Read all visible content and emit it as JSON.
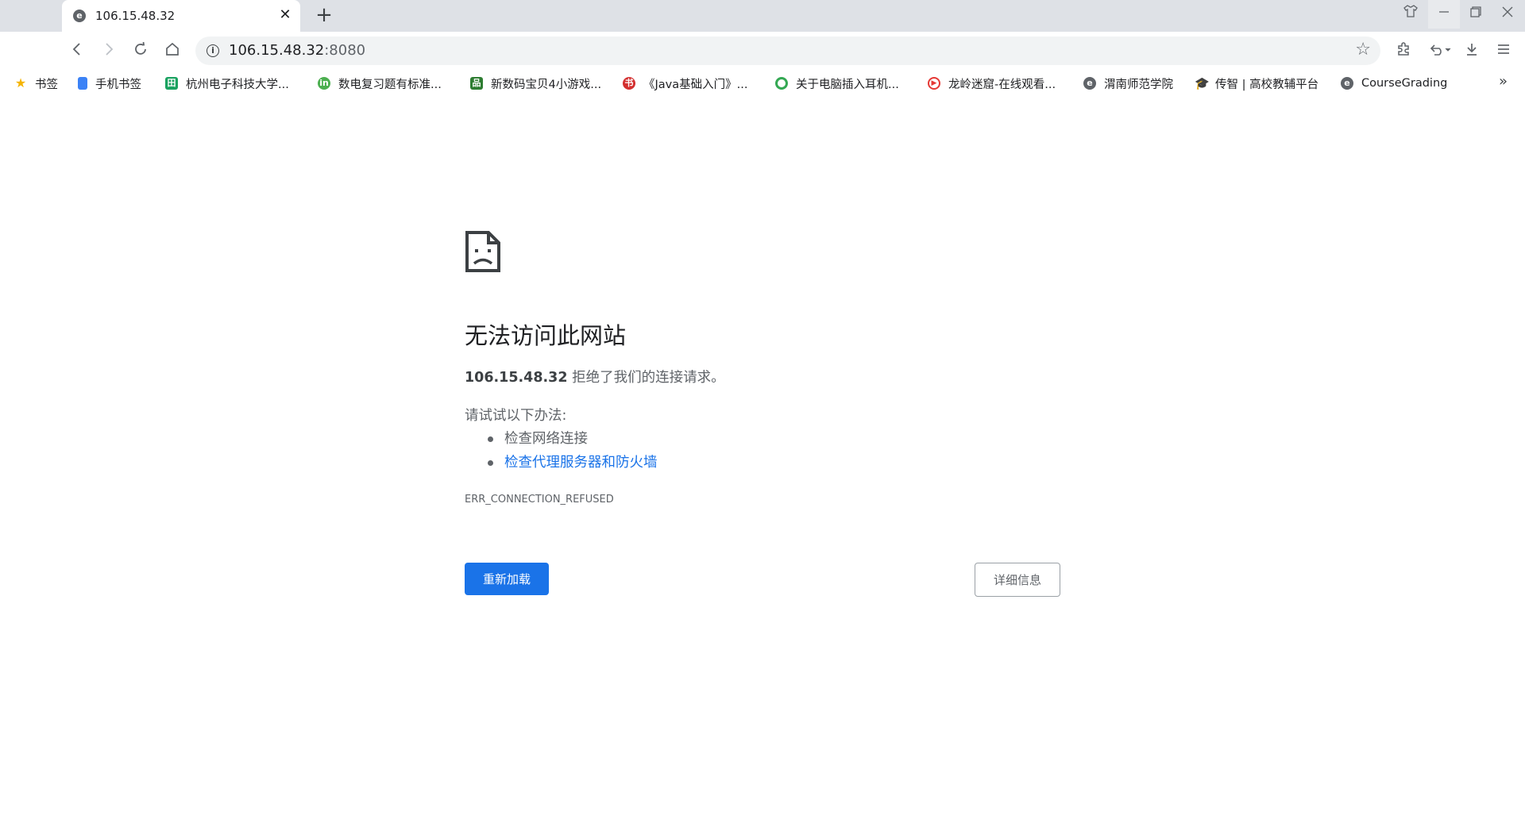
{
  "browser": {
    "tab": {
      "title": "106.15.48.32",
      "favicon": "e-icon"
    },
    "new_tab_symbol": "+",
    "window_controls": [
      "shirt-icon",
      "minimize-icon",
      "restore-icon",
      "close-icon"
    ]
  },
  "toolbar": {
    "url_host": "106.15.48.32",
    "url_port": ":8080",
    "icons": [
      "back-icon",
      "forward-icon",
      "reload-icon",
      "home-icon",
      "info-icon",
      "star-icon",
      "extensions-icon",
      "undo-icon",
      "download-icon",
      "menu-icon"
    ]
  },
  "bookmarks": {
    "items": [
      {
        "label": "书签",
        "icon": "star-icon",
        "color": "#f5b400"
      },
      {
        "label": "手机书签",
        "icon": "phone-icon",
        "color": "#3b82f6"
      },
      {
        "label": "杭州电子科技大学...",
        "icon": "school-icon",
        "color": "#1aa260"
      },
      {
        "label": "数电复习题有标准...",
        "icon": "in-icon",
        "color": "#4caf50"
      },
      {
        "label": "新数码宝贝4小游戏...",
        "icon": "game-icon",
        "color": "#2e7d32"
      },
      {
        "label": "《Java基础入门》...",
        "icon": "book-icon",
        "color": "#d32f2f"
      },
      {
        "label": "关于电脑插入耳机...",
        "icon": "search-icon",
        "color": "#34a853"
      },
      {
        "label": "龙岭迷窟-在线观看...",
        "icon": "play-icon",
        "color": "#e53935"
      },
      {
        "label": "渭南师范学院",
        "icon": "e-icon",
        "color": "#5f6368"
      },
      {
        "label": "传智 | 高校教辅平台",
        "icon": "cap-icon",
        "color": "#2e7d32"
      },
      {
        "label": "CourseGrading",
        "icon": "e-icon",
        "color": "#5f6368"
      }
    ],
    "more": "»"
  },
  "error_page": {
    "heading": "无法访问此网站",
    "host": "106.15.48.32",
    "description_suffix": " 拒绝了我们的连接请求。",
    "suggestions_title": "请试试以下办法:",
    "suggestions": [
      "检查网络连接",
      "检查代理服务器和防火墙"
    ],
    "error_code": "ERR_CONNECTION_REFUSED",
    "reload_label": "重新加载",
    "details_label": "详细信息",
    "accent_color": "#1a73e8"
  }
}
